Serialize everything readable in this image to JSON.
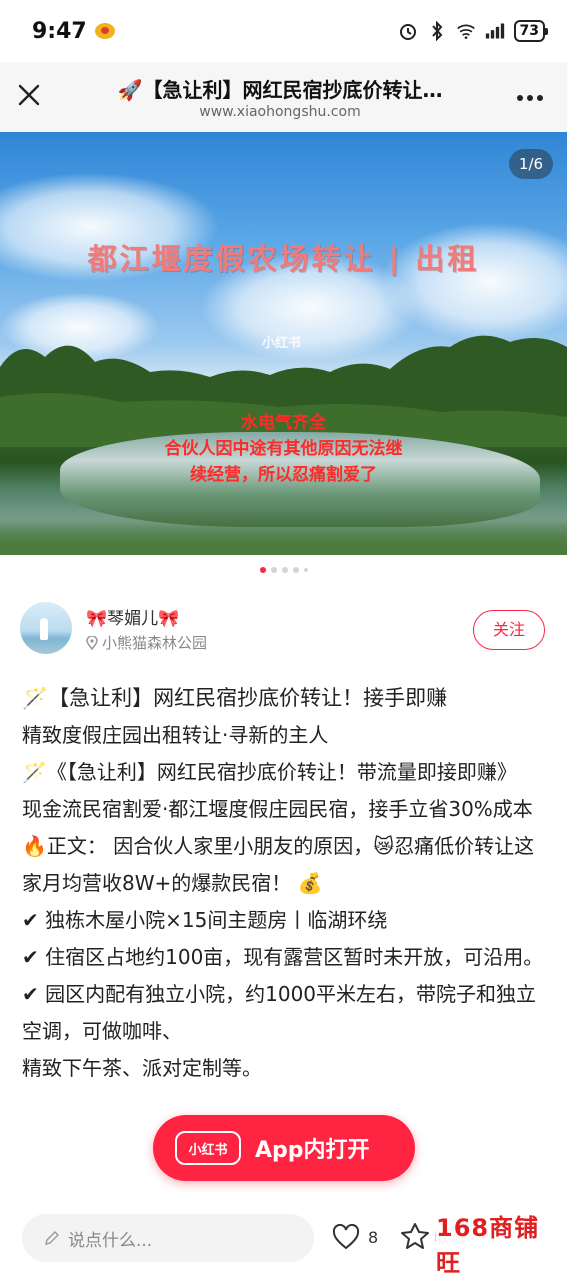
{
  "status_bar": {
    "time": "9:47",
    "battery": "73",
    "icons": [
      "weibo-icon",
      "alarm-icon",
      "bluetooth-icon",
      "wifi-icon",
      "signal-icon",
      "battery-icon"
    ]
  },
  "title_bar": {
    "title": "🚀【急让利】网红民宿抄底价转让…",
    "url": "www.xiaohongshu.com"
  },
  "hero": {
    "headline": "都江堰度假农场转让 | 出租",
    "watermark": "小红书",
    "caption_line1": "水电气齐全",
    "caption_line2": "合伙人因中途有其他原因无法继",
    "caption_line3": "续经营，所以忍痛割爱了",
    "page_indicator": "1/6"
  },
  "author": {
    "name": "🎀琴媚儿🎀",
    "location": "小熊猫森林公园",
    "follow_label": "关注"
  },
  "post": {
    "line1": "🪄【急让利】网红民宿抄底价转让！接手即赚",
    "line2": "精致度假庄园出租转让·寻新的主人",
    "line3": "🪄《【急让利】网红民宿抄底价转让！带流量即接即赚》",
    "line4": "现金流民宿割爱·都江堰度假庄园民宿，接手立省30%成本",
    "line5": "🔥正文： 因合伙人家里小朋友的原因，😿忍痛低价转让这家月均营收8W+的爆款民宿！ 💰",
    "line6": "✔ 独栋木屋小院×15间主题房丨临湖环绕",
    "line7": "✔ 住宿区占地约100亩，现有露营区暂时未开放，可沿用。",
    "line8": "✔ 园区内配有独立小院，约1000平米左右，带院子和独立空调，",
    "line8_tail": "可做咖啡、",
    "line9": "精致下午茶、派对定制等。"
  },
  "open_app": {
    "logo": "小红书",
    "label": "App内打开"
  },
  "bottom_bar": {
    "comment_placeholder": "说点什么...",
    "likes": "8",
    "star_label": "收藏"
  },
  "watermark": "168商铺旺",
  "colors": {
    "brand_red": "#ff2442",
    "hero_caption": "#ff2a2a",
    "hero_headline": "#f07b7b"
  }
}
